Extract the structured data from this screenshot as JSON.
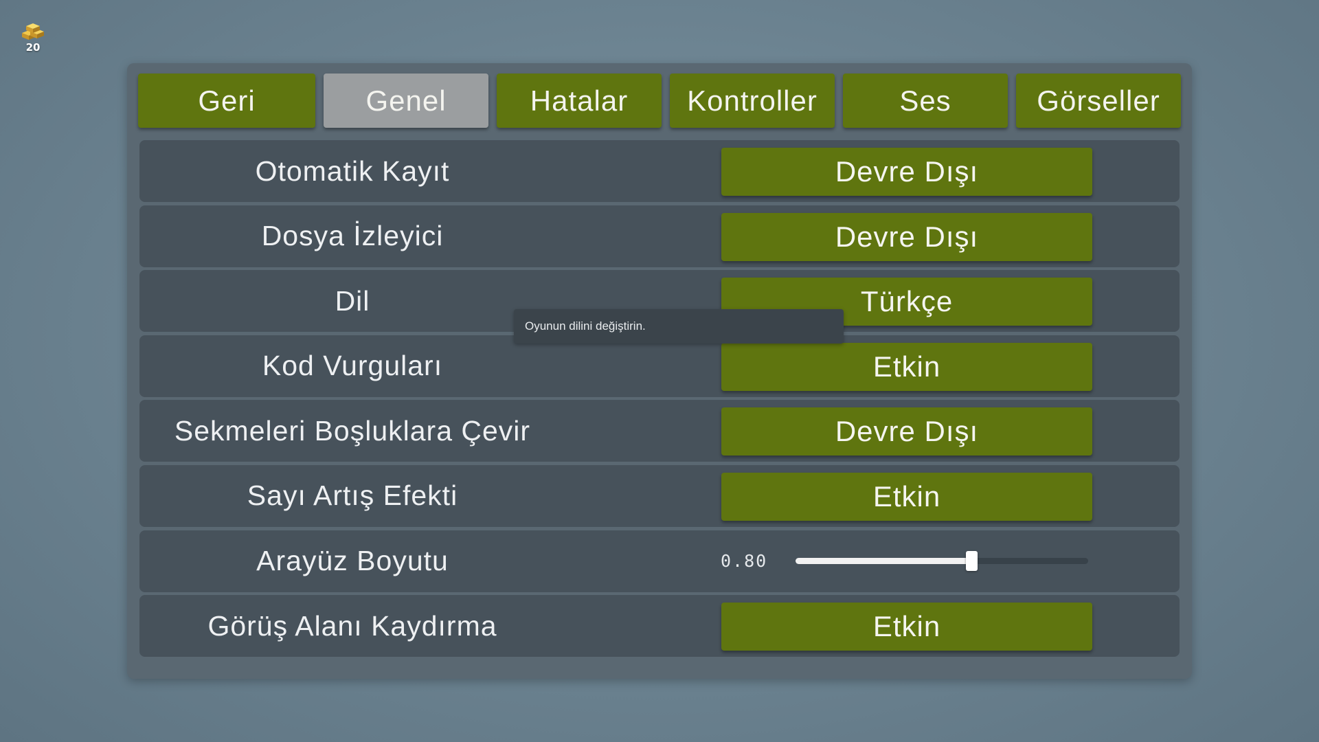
{
  "hud": {
    "gold_icon": "gold-bars-icon",
    "gold_count": "20"
  },
  "tabs": [
    {
      "label": "Geri",
      "active": false
    },
    {
      "label": "Genel",
      "active": true
    },
    {
      "label": "Hatalar",
      "active": false
    },
    {
      "label": "Kontroller",
      "active": false
    },
    {
      "label": "Ses",
      "active": false
    },
    {
      "label": "Görseller",
      "active": false
    }
  ],
  "settings": {
    "autosave": {
      "label": "Otomatik Kayıt",
      "value": "Devre Dışı"
    },
    "file_watcher": {
      "label": "Dosya İzleyici",
      "value": "Devre Dışı"
    },
    "language": {
      "label": "Dil",
      "value": "Türkçe"
    },
    "code_highlights": {
      "label": "Kod Vurguları",
      "value": "Etkin"
    },
    "tabs_to_spaces": {
      "label": "Sekmeleri Boşluklara Çevir",
      "value": "Devre Dışı"
    },
    "number_effect": {
      "label": "Sayı Artış Efekti",
      "value": "Etkin"
    },
    "ui_scale": {
      "label": "Arayüz Boyutu",
      "value_text": "0.80",
      "fraction": 0.6
    },
    "viewport_scroll": {
      "label": "Görüş Alanı Kaydırma",
      "value": "Etkin"
    }
  },
  "tooltip": {
    "text": "Oyunun dilini değiştirin."
  },
  "colors": {
    "accent_green": "#5f750f",
    "active_tab": "#9b9ea0",
    "panel": "#5a6872",
    "row": "#47525b"
  }
}
